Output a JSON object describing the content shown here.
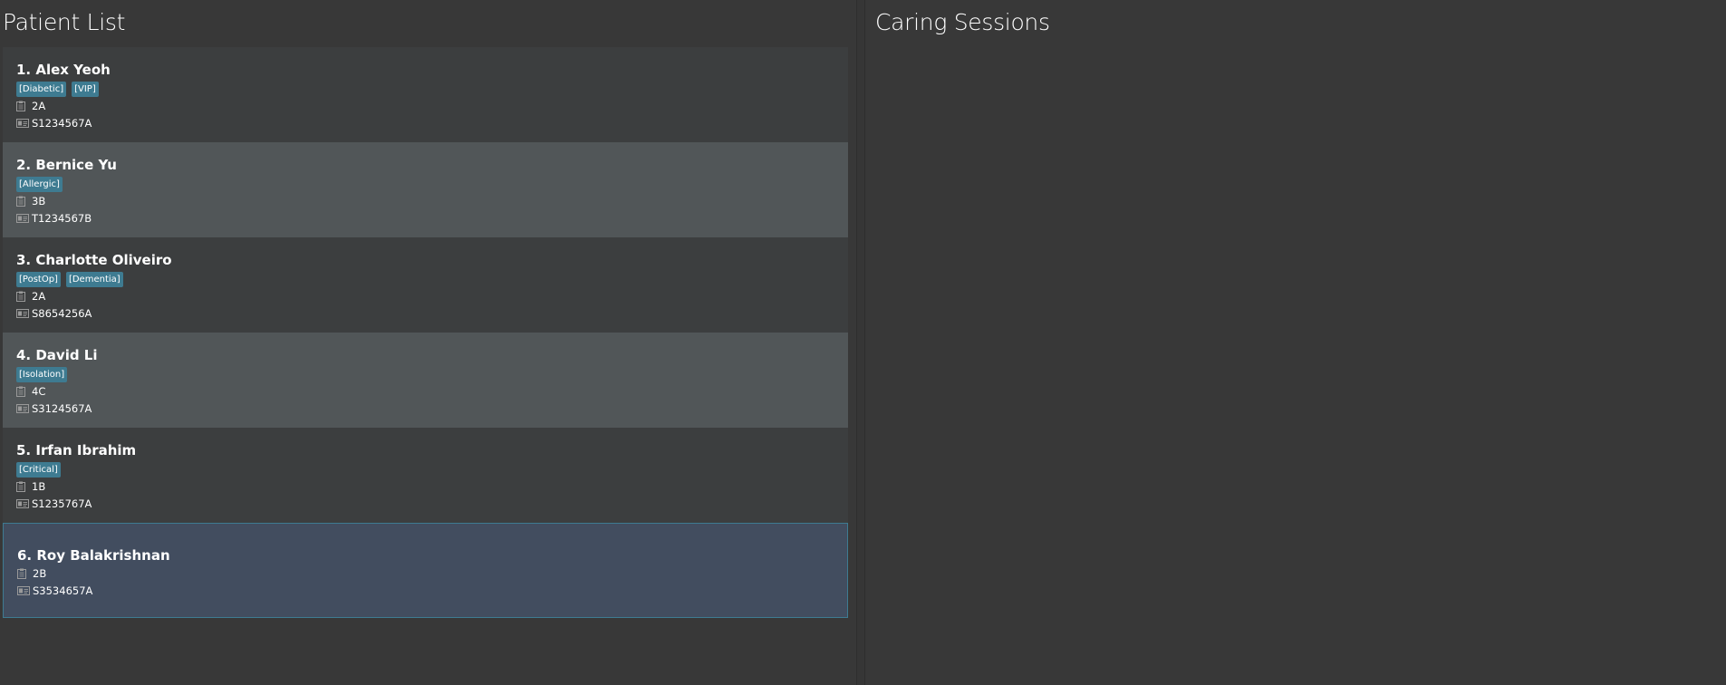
{
  "left_panel": {
    "title": "Patient List"
  },
  "right_panel": {
    "title": "Caring Sessions"
  },
  "patients": [
    {
      "name": "1. Alex Yeoh",
      "tags": [
        "[Diabetic]",
        "[VIP]"
      ],
      "ward": "2A",
      "nric": "S1234567A",
      "icons": {
        "ward": "clipboard-icon",
        "id": "id-card-icon"
      }
    },
    {
      "name": "2. Bernice Yu",
      "tags": [
        "[Allergic]"
      ],
      "ward": "3B",
      "nric": "T1234567B",
      "icons": {
        "ward": "clipboard-icon",
        "id": "id-card-icon"
      }
    },
    {
      "name": "3. Charlotte Oliveiro",
      "tags": [
        "[PostOp]",
        "[Dementia]"
      ],
      "ward": "2A",
      "nric": "S8654256A",
      "icons": {
        "ward": "clipboard-icon",
        "id": "id-card-icon"
      }
    },
    {
      "name": "4. David Li",
      "tags": [
        "[Isolation]"
      ],
      "ward": "4C",
      "nric": "S3124567A",
      "icons": {
        "ward": "clipboard-icon",
        "id": "id-card-icon"
      }
    },
    {
      "name": "5. Irfan Ibrahim",
      "tags": [
        "[Critical]"
      ],
      "ward": "1B",
      "nric": "S1235767A",
      "icons": {
        "ward": "clipboard-icon",
        "id": "id-card-icon"
      }
    },
    {
      "name": "6. Roy Balakrishnan",
      "tags": [],
      "ward": "2B",
      "nric": "S3534657A",
      "icons": {
        "ward": "clipboard-icon",
        "id": "id-card-icon"
      }
    }
  ],
  "selected_index": 5,
  "colors": {
    "background": "#383838",
    "card_odd": "#3c3e3f",
    "card_even": "#515658",
    "card_selected": "#424d5f",
    "selected_border": "#3e7b91",
    "tag_background": "#3e7b91"
  }
}
